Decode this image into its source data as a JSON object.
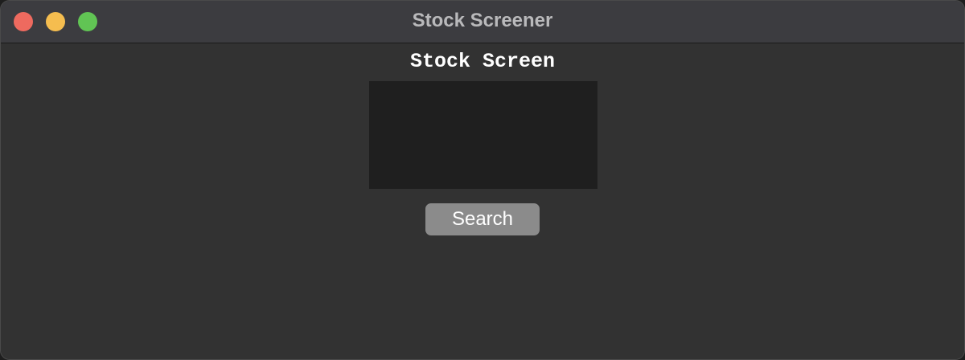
{
  "window": {
    "title": "Stock Screener",
    "controls": {
      "close_color": "#ee6a5f",
      "minimize_color": "#f5bd4f",
      "zoom_color": "#61c454"
    }
  },
  "main": {
    "heading": "Stock Screen",
    "text_area": {
      "value": "",
      "placeholder": ""
    },
    "search_button_label": "Search"
  }
}
